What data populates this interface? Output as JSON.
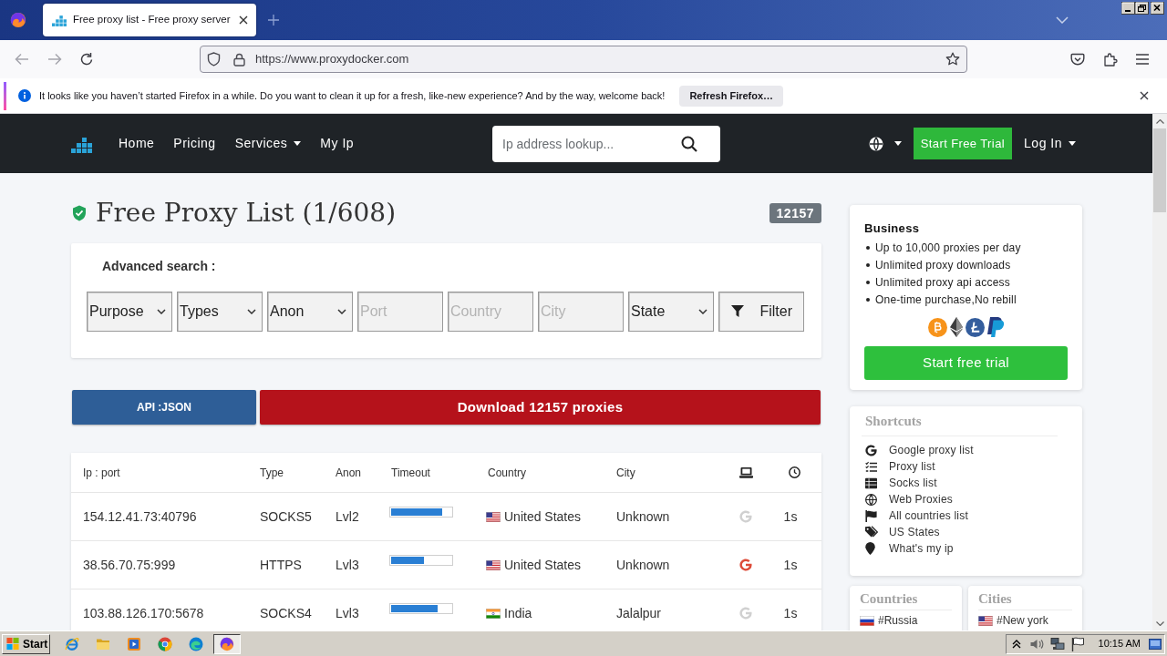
{
  "browser": {
    "tabs": [
      {
        "title": "Free proxy list - Free proxy server",
        "selected": true
      }
    ],
    "url": "https://www.proxydocker.com",
    "notification": {
      "message": "It looks like you haven’t started Firefox in a while. Do you want to clean it up for a fresh, like-new experience? And by the way, welcome back!",
      "button": "Refresh Firefox…"
    }
  },
  "site_header": {
    "nav": [
      {
        "label": "Home",
        "has_menu": false
      },
      {
        "label": "Pricing",
        "has_menu": false
      },
      {
        "label": "Services",
        "has_menu": true
      },
      {
        "label": "My Ip",
        "has_menu": false
      }
    ],
    "search": {
      "placeholder": "Ip address lookup..."
    },
    "trial_button": "Start Free Trial",
    "login": {
      "label": "Log In",
      "has_menu": true
    }
  },
  "page": {
    "title": "Free Proxy List (1/608)",
    "badge": "12157"
  },
  "advanced_search": {
    "title": "Advanced search :",
    "fields": [
      {
        "kind": "select",
        "value": "Purpose"
      },
      {
        "kind": "select",
        "value": "Types"
      },
      {
        "kind": "select",
        "value": "Anon"
      },
      {
        "kind": "input",
        "placeholder": "Port"
      },
      {
        "kind": "input",
        "placeholder": "Country"
      },
      {
        "kind": "input",
        "placeholder": "City"
      },
      {
        "kind": "select",
        "value": "State"
      }
    ],
    "filter_button": "Filter"
  },
  "actions": {
    "api_button": "API :JSON",
    "download_button": "Download 12157 proxies"
  },
  "table": {
    "columns": [
      "Ip : port",
      "Type",
      "Anon",
      "Timeout",
      "Country",
      "City"
    ],
    "rows": [
      {
        "ip_port": "154.12.41.73:40796",
        "type": "SOCKS5",
        "anon": "Lvl2",
        "timeout": {
          "level": 0.85
        },
        "flag": {
          "kind": "us"
        },
        "country": "United States",
        "city": "Unknown",
        "google_highlighted": false,
        "time": "1s"
      },
      {
        "ip_port": "38.56.70.75:999",
        "type": "HTTPS",
        "anon": "Lvl3",
        "timeout": {
          "level": 0.54
        },
        "flag": {
          "kind": "us"
        },
        "country": "United States",
        "city": "Unknown",
        "google_highlighted": true,
        "time": "1s"
      },
      {
        "ip_port": "103.88.126.170:5678",
        "type": "SOCKS4",
        "anon": "Lvl3",
        "timeout": {
          "level": 0.78
        },
        "flag": {
          "kind": "in"
        },
        "country": "India",
        "city": "Jalalpur",
        "google_highlighted": false,
        "time": "1s"
      }
    ]
  },
  "sidebar": {
    "business": {
      "title": "Business",
      "features": [
        "Up to 10,000 proxies per day",
        "Unlimited proxy downloads",
        "Unlimited proxy api access",
        "One-time purchase,No rebill"
      ],
      "button": "Start free trial"
    },
    "shortcuts": {
      "title": "Shortcuts",
      "items": [
        {
          "kind": "google",
          "label": "Google proxy list"
        },
        {
          "kind": "list",
          "label": "Proxy list"
        },
        {
          "kind": "table",
          "label": "Socks list"
        },
        {
          "kind": "globe",
          "label": "Web Proxies"
        },
        {
          "kind": "flag",
          "label": "All countries list"
        },
        {
          "kind": "tags",
          "label": "US States"
        },
        {
          "kind": "pin",
          "label": "What's my ip"
        }
      ]
    },
    "countries": {
      "title": "Countries",
      "items": [
        {
          "flag": {
            "kind": "ru"
          },
          "label": "#Russia"
        }
      ]
    },
    "cities": {
      "title": "Cities",
      "items": [
        {
          "flag": {
            "kind": "us"
          },
          "label": "#New york"
        }
      ]
    }
  },
  "taskbar": {
    "start": "Start",
    "apps": [
      {
        "kind": "ie",
        "selected": false
      },
      {
        "kind": "folder",
        "selected": false
      },
      {
        "kind": "media",
        "selected": false
      },
      {
        "kind": "chrome",
        "selected": false
      },
      {
        "kind": "edge",
        "selected": false
      },
      {
        "kind": "firefox",
        "selected": true
      }
    ],
    "clock": "10:15 AM"
  }
}
